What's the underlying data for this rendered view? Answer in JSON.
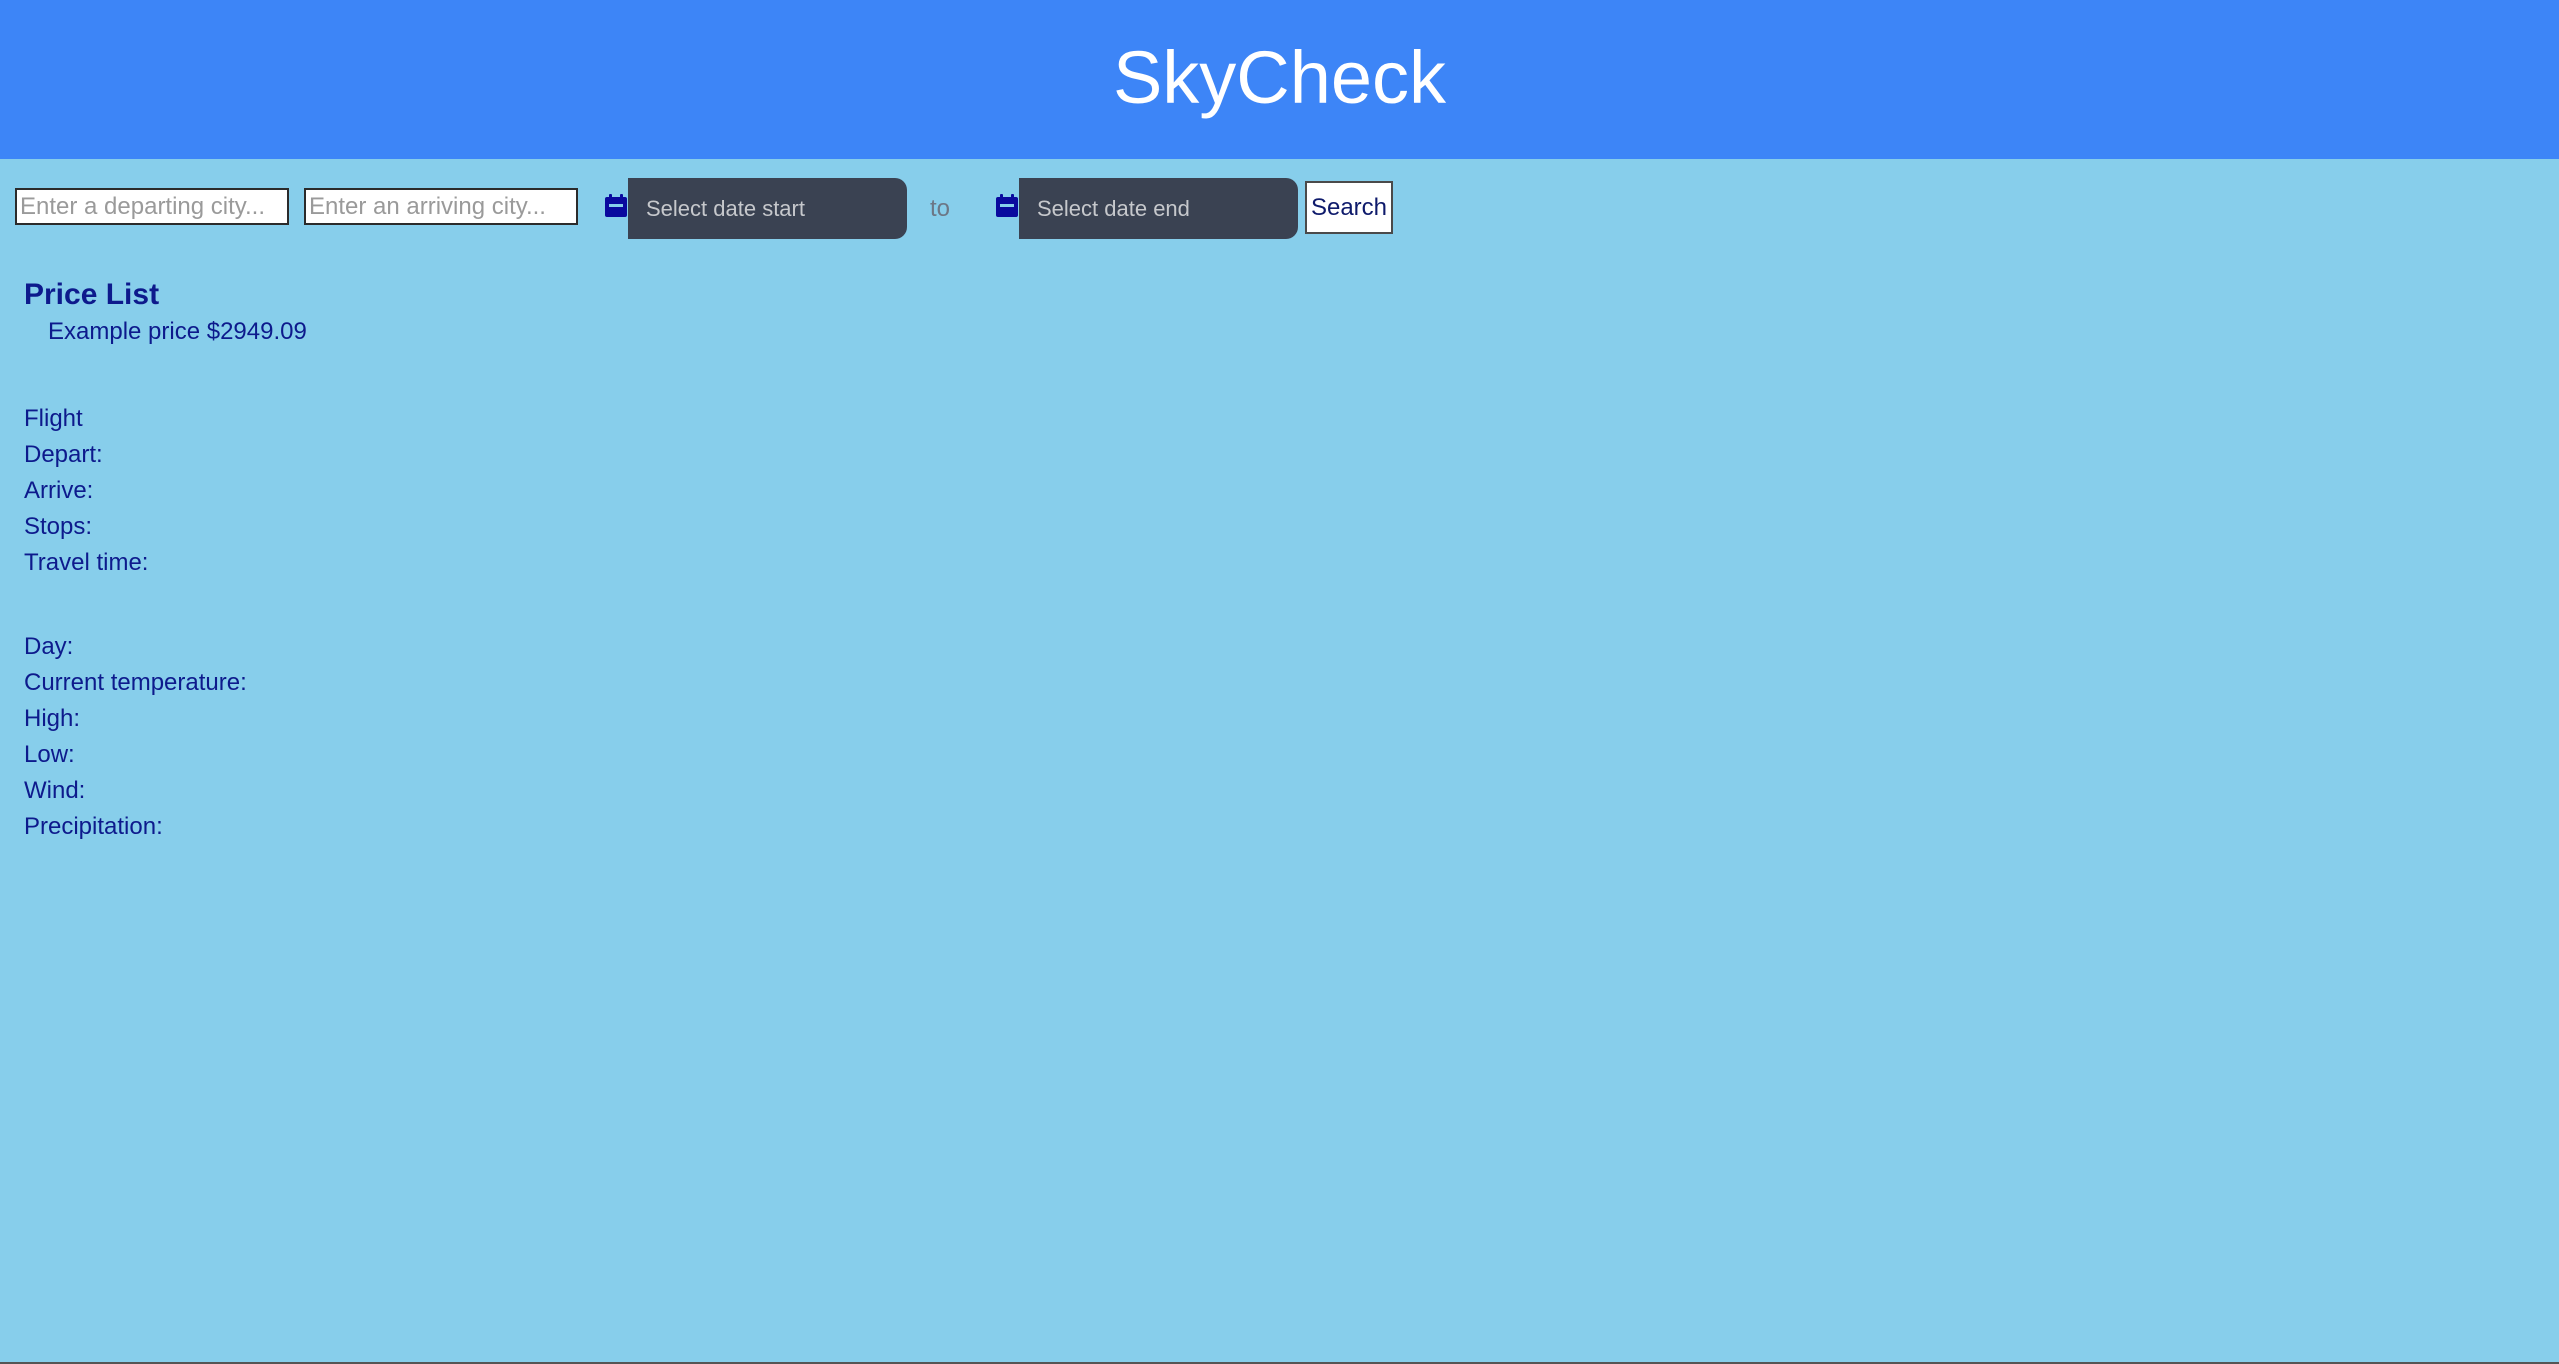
{
  "header": {
    "title": "SkyCheck"
  },
  "search": {
    "depart_placeholder": "Enter a departing city...",
    "arrive_placeholder": "Enter an arriving city...",
    "date_start_placeholder": "Select date start",
    "date_end_placeholder": "Select date end",
    "to_label": "to",
    "search_label": "Search"
  },
  "price_list": {
    "title": "Price List",
    "items": [
      "Example price $2949.09"
    ]
  },
  "flight": {
    "heading": "Flight",
    "depart": "Depart:",
    "arrive": "Arrive:",
    "stops": "Stops:",
    "travel_time": "Travel time:"
  },
  "weather": {
    "day": "Day:",
    "current_temperature": "Current temperature:",
    "high": "High:",
    "low": "Low:",
    "wind": "Wind:",
    "precipitation": "Precipitation:"
  },
  "colors": {
    "header_bg": "#3d85f7",
    "page_bg": "#87ceeb",
    "date_field_bg": "#3a4252",
    "text": "#0d1a8c",
    "calendar_icon": "#0a0a9e"
  },
  "icons": {
    "date_start": "calendar-icon",
    "date_end": "calendar-icon"
  }
}
